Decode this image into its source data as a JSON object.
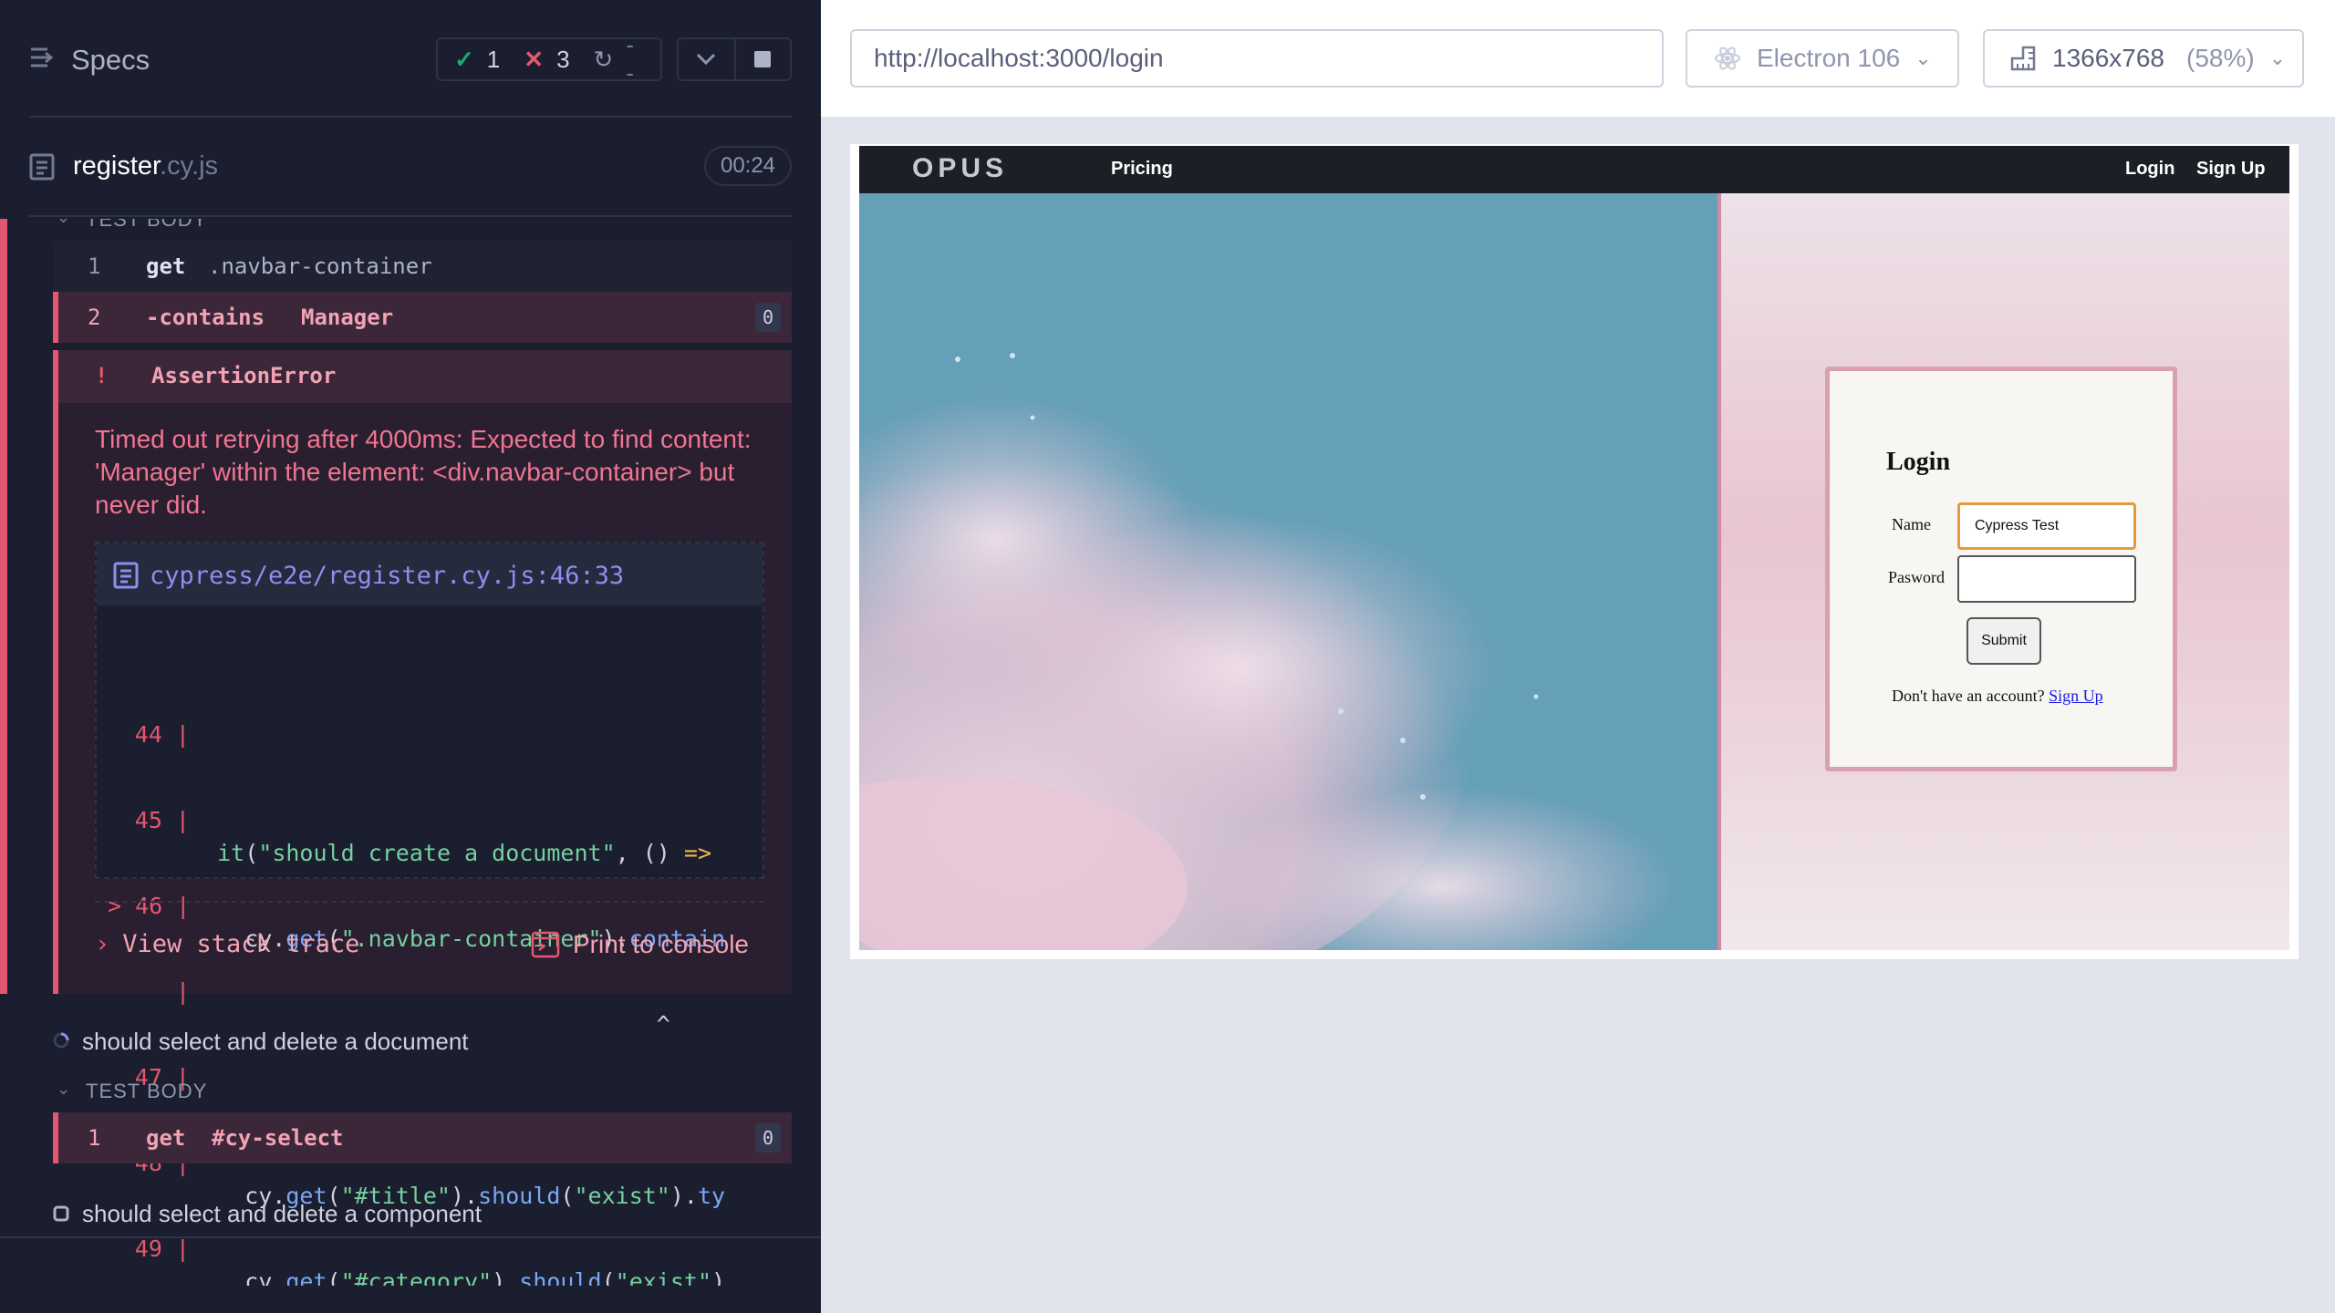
{
  "reporter": {
    "title": "Specs",
    "stats": {
      "passed": "1",
      "failed": "3",
      "pending": "--"
    },
    "spec": {
      "name": "register",
      "ext": ".cy.js",
      "duration": "00:24"
    },
    "test_body_label": "TEST BODY",
    "commands_block1": [
      {
        "num": "1",
        "name": "get",
        "arg": ".navbar-container"
      },
      {
        "num": "2",
        "name": "-contains",
        "arg": "Manager",
        "count": "0"
      }
    ],
    "error": {
      "icon": "!",
      "title": "AssertionError",
      "message": "Timed out retrying after 4000ms: Expected to find content: 'Manager' within the element: <div.navbar-container> but never did.",
      "file_path": "cypress/e2e/register.cy.js:46:33",
      "code_lines": [
        {
          "ln": "44 |",
          "code": ""
        },
        {
          "ln": "45 |",
          "code": "  it(\"should create a document\", () =>"
        },
        {
          "ln": "> 46 |",
          "code": "    cy.get(\".navbar-container\").contain"
        },
        {
          "ln": "|",
          "code": "                                  ^"
        },
        {
          "ln": "47 |",
          "code": ""
        },
        {
          "ln": "48 |",
          "code": "    cy.get(\"#title\").should(\"exist\").ty"
        },
        {
          "ln": "49 |",
          "code": "    cy.get(\"#category\").should(\"exist\")"
        }
      ],
      "view_stack": "View stack trace",
      "print_console": "Print to console"
    },
    "test2": {
      "title": "should select and delete a document",
      "body_label": "TEST BODY",
      "command": {
        "num": "1",
        "name": "get",
        "arg": "#cy-select",
        "count": "0"
      }
    },
    "test3": {
      "title": "should select and delete a component"
    }
  },
  "aut": {
    "url": "http://localhost:3000/login",
    "browser": "Electron 106",
    "viewport": "1366x768",
    "scale": "(58%)",
    "app": {
      "logo": "OPUS",
      "nav_pricing": "Pricing",
      "nav_login": "Login",
      "nav_signup": "Sign Up",
      "login_title": "Login",
      "name_label": "Name",
      "name_value": "Cypress Test",
      "password_label": "Pasword",
      "submit": "Submit",
      "footer_text": "Don't have an account?",
      "footer_link": "Sign Up"
    }
  },
  "colors": {
    "fail": "#e45770",
    "pass": "#1fa971",
    "accent": "#8b8ff0"
  }
}
